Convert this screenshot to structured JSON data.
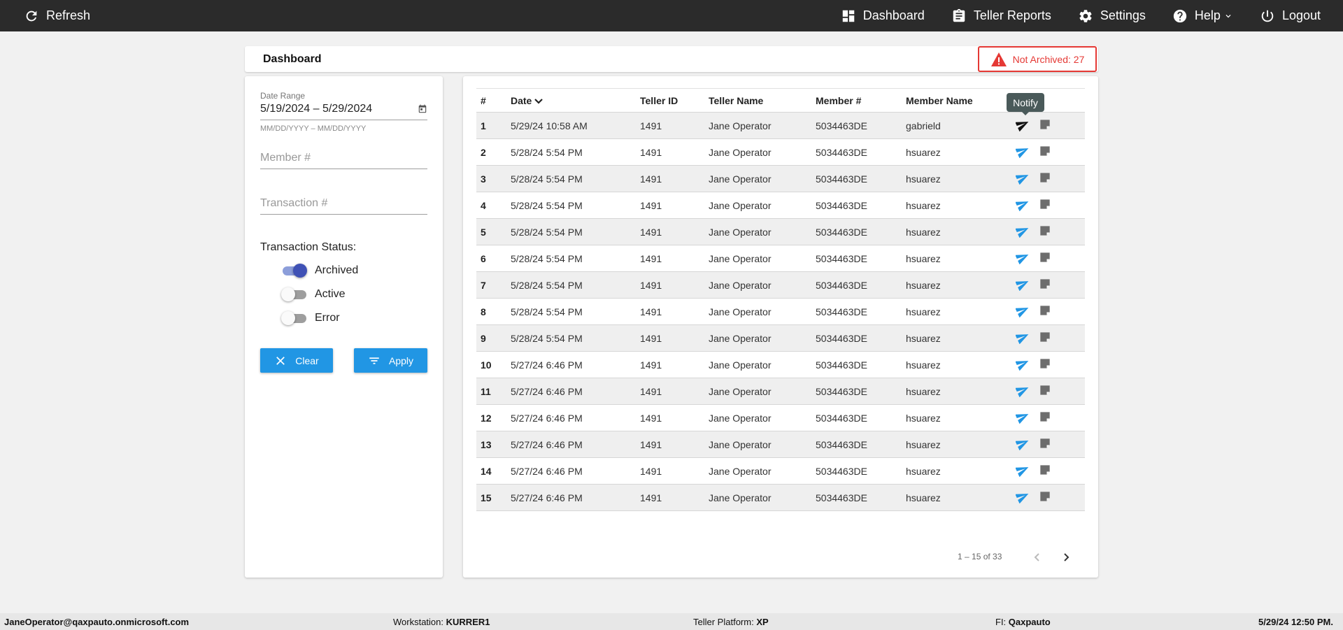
{
  "topbar": {
    "refresh_label": "Refresh",
    "nav": [
      {
        "label": "Dashboard",
        "icon": "dashboard-icon"
      },
      {
        "label": "Teller Reports",
        "icon": "clipboard-icon"
      },
      {
        "label": "Settings",
        "icon": "gear-icon"
      },
      {
        "label": "Help",
        "icon": "help-icon"
      },
      {
        "label": "Logout",
        "icon": "power-icon"
      }
    ]
  },
  "header": {
    "title": "Dashboard",
    "alert": "Not Archived: 27",
    "alert_color": "#e53935"
  },
  "filters": {
    "date_range_label": "Date Range",
    "date_range_value": "5/19/2024 – 5/29/2024",
    "date_hint": "MM/DD/YYYY – MM/DD/YYYY",
    "member_placeholder": "Member #",
    "transaction_placeholder": "Transaction #",
    "status_title": "Transaction Status:",
    "statuses": [
      {
        "label": "Archived",
        "on": true
      },
      {
        "label": "Active",
        "on": false
      },
      {
        "label": "Error",
        "on": false
      }
    ],
    "clear_label": "Clear",
    "apply_label": "Apply"
  },
  "table": {
    "columns": [
      "#",
      "Date",
      "Teller ID",
      "Teller Name",
      "Member #",
      "Member Name"
    ],
    "rows": [
      [
        "1",
        "5/29/24 10:58 AM",
        "1491",
        "Jane Operator",
        "5034463DE",
        "gabrield"
      ],
      [
        "2",
        "5/28/24 5:54 PM",
        "1491",
        "Jane Operator",
        "5034463DE",
        "hsuarez"
      ],
      [
        "3",
        "5/28/24 5:54 PM",
        "1491",
        "Jane Operator",
        "5034463DE",
        "hsuarez"
      ],
      [
        "4",
        "5/28/24 5:54 PM",
        "1491",
        "Jane Operator",
        "5034463DE",
        "hsuarez"
      ],
      [
        "5",
        "5/28/24 5:54 PM",
        "1491",
        "Jane Operator",
        "5034463DE",
        "hsuarez"
      ],
      [
        "6",
        "5/28/24 5:54 PM",
        "1491",
        "Jane Operator",
        "5034463DE",
        "hsuarez"
      ],
      [
        "7",
        "5/28/24 5:54 PM",
        "1491",
        "Jane Operator",
        "5034463DE",
        "hsuarez"
      ],
      [
        "8",
        "5/28/24 5:54 PM",
        "1491",
        "Jane Operator",
        "5034463DE",
        "hsuarez"
      ],
      [
        "9",
        "5/28/24 5:54 PM",
        "1491",
        "Jane Operator",
        "5034463DE",
        "hsuarez"
      ],
      [
        "10",
        "5/27/24 6:46 PM",
        "1491",
        "Jane Operator",
        "5034463DE",
        "hsuarez"
      ],
      [
        "11",
        "5/27/24 6:46 PM",
        "1491",
        "Jane Operator",
        "5034463DE",
        "hsuarez"
      ],
      [
        "12",
        "5/27/24 6:46 PM",
        "1491",
        "Jane Operator",
        "5034463DE",
        "hsuarez"
      ],
      [
        "13",
        "5/27/24 6:46 PM",
        "1491",
        "Jane Operator",
        "5034463DE",
        "hsuarez"
      ],
      [
        "14",
        "5/27/24 6:46 PM",
        "1491",
        "Jane Operator",
        "5034463DE",
        "hsuarez"
      ],
      [
        "15",
        "5/27/24 6:46 PM",
        "1491",
        "Jane Operator",
        "5034463DE",
        "hsuarez"
      ]
    ],
    "tooltip": "Notify",
    "accent_color": "#2196e4"
  },
  "paginator": {
    "range": "1 – 15 of 33"
  },
  "footer": {
    "user": "JaneOperator@qaxpauto.onmicrosoft.com",
    "workstation_label": "Workstation:",
    "workstation": "KURRER1",
    "platform_label": "Teller Platform:",
    "platform": "XP",
    "fi_label": "FI:",
    "fi": "Qaxpauto",
    "datetime": "5/29/24 12:50 PM."
  }
}
